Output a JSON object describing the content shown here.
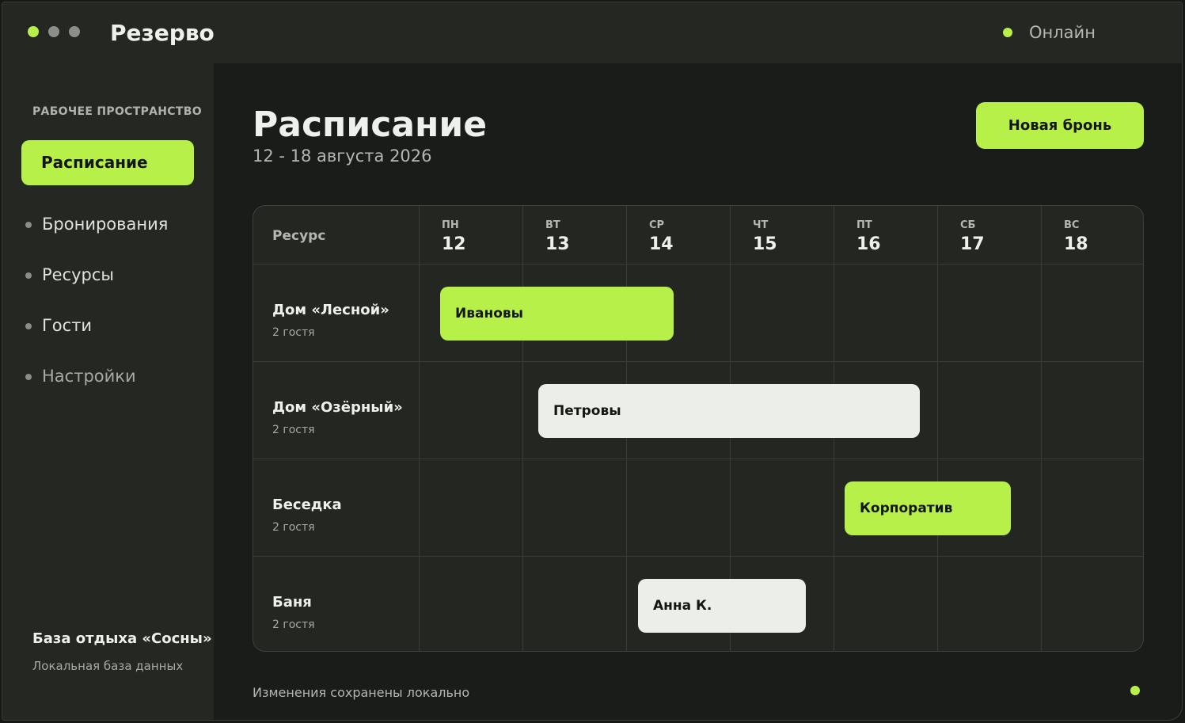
{
  "app": {
    "title": "Резерво",
    "status": "Онлайн"
  },
  "sidebar": {
    "section_label": "РАБОЧЕЕ ПРОСТРАНСТВО",
    "items": [
      {
        "label": "Расписание"
      },
      {
        "label": "Бронирования"
      },
      {
        "label": "Ресурсы"
      },
      {
        "label": "Гости"
      },
      {
        "label": "Настройки"
      }
    ],
    "org_name": "База отдыха «Сосны»",
    "org_sub": "Локальная база данных"
  },
  "main": {
    "title": "Расписание",
    "subtitle": "12 - 18 августа 2026",
    "new_button": "Новая бронь",
    "footer_text": "Изменения сохранены локально"
  },
  "schedule": {
    "resource_header": "Ресурс",
    "days": [
      {
        "name": "ПН",
        "date": "12"
      },
      {
        "name": "ВТ",
        "date": "13"
      },
      {
        "name": "СР",
        "date": "14"
      },
      {
        "name": "ЧТ",
        "date": "15"
      },
      {
        "name": "ПТ",
        "date": "16"
      },
      {
        "name": "СБ",
        "date": "17"
      },
      {
        "name": "ВС",
        "date": "18"
      }
    ],
    "resources": [
      {
        "name": "Дом «Лесной»",
        "capacity": "2 гостя"
      },
      {
        "name": "Дом «Озёрный»",
        "capacity": "2 гостя"
      },
      {
        "name": "Беседка",
        "capacity": "2 гостя"
      },
      {
        "name": "Баня",
        "capacity": "2 гостя"
      }
    ],
    "bookings": [
      {
        "label": "Ивановы",
        "resource": 0,
        "start_day": "12",
        "end_day": "14",
        "style": "green"
      },
      {
        "label": "Петровы",
        "resource": 1,
        "start_day": "13",
        "end_day": "16",
        "style": "white"
      },
      {
        "label": "Корпоратив",
        "resource": 2,
        "start_day": "16",
        "end_day": "17",
        "style": "green"
      },
      {
        "label": "Анна К.",
        "resource": 3,
        "start_day": "14",
        "end_day": "15",
        "style": "white"
      }
    ]
  },
  "colors": {
    "accent": "#b8f04a",
    "booking_light": "#eceee9",
    "background": "#1a1c19",
    "panel": "#252723"
  }
}
